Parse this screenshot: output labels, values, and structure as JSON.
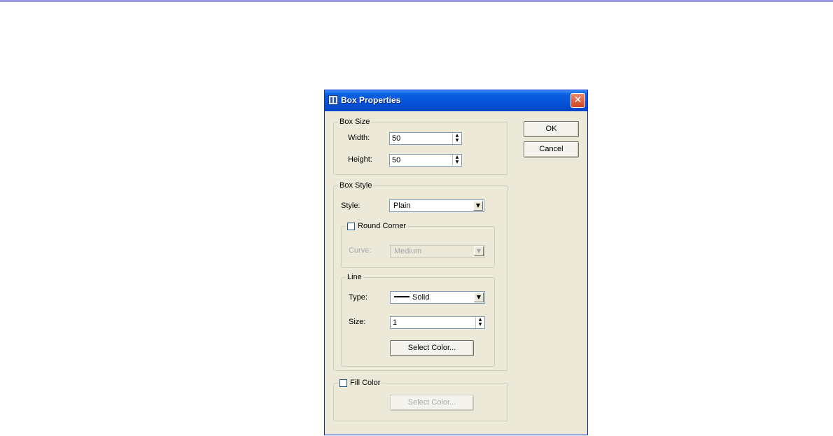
{
  "dialog": {
    "title": "Box Properties",
    "close_glyph": "✕",
    "ok_label": "OK",
    "cancel_label": "Cancel"
  },
  "box_size": {
    "caption": "Box Size",
    "width_label": "Width:",
    "width_value": "50",
    "height_label": "Height:",
    "height_value": "50"
  },
  "box_style": {
    "caption": "Box Style",
    "style_label": "Style:",
    "style_value": "Plain",
    "round_corner": {
      "caption": "Round Corner",
      "checked": false,
      "curve_label": "Curve:",
      "curve_value": "Medium"
    },
    "line": {
      "caption": "Line",
      "type_label": "Type:",
      "type_value": "Solid",
      "size_label": "Size:",
      "size_value": "1",
      "select_color_label": "Select Color..."
    }
  },
  "fill_color": {
    "caption": "Fill Color",
    "checked": false,
    "select_color_label": "Select Color..."
  },
  "icons": {
    "dropdown": "▼",
    "spin_up": "▲",
    "spin_down": "▼"
  },
  "colors": {
    "titlebar": "#0552d9",
    "dialog_face": "#ece9d8",
    "close_button": "#d4451f"
  }
}
